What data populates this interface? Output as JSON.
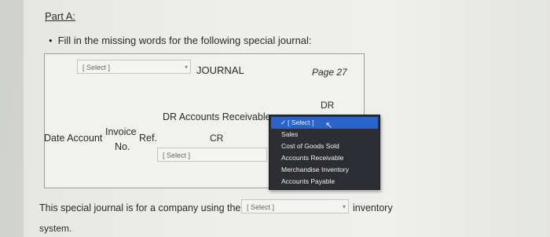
{
  "heading": "Part A:",
  "instruction": "Fill in the missing words for the following special journal:",
  "journal": {
    "name_select": "[ Select ]",
    "title_suffix": "JOURNAL",
    "page": "Page 27",
    "col_dr": "DR",
    "col_dr_accounts_receivable": "DR Accounts Receivable",
    "col_date": "Date",
    "col_account": "Account",
    "col_invoice": "Invoice",
    "col_no": "No.",
    "col_ref": "Ref.",
    "col_cr": "CR",
    "cr_select": "[ Select ]"
  },
  "dropdown": {
    "options": [
      "[ Select ]",
      "Sales",
      "Cost of Goods Sold",
      "Accounts Receivable",
      "Merchandise Inventory",
      "Accounts Payable"
    ],
    "selected_index": 0
  },
  "sentence": {
    "prefix": "This special journal is for a company using the",
    "select": "[ Select ]",
    "suffix": "inventory",
    "continuation": "system."
  }
}
